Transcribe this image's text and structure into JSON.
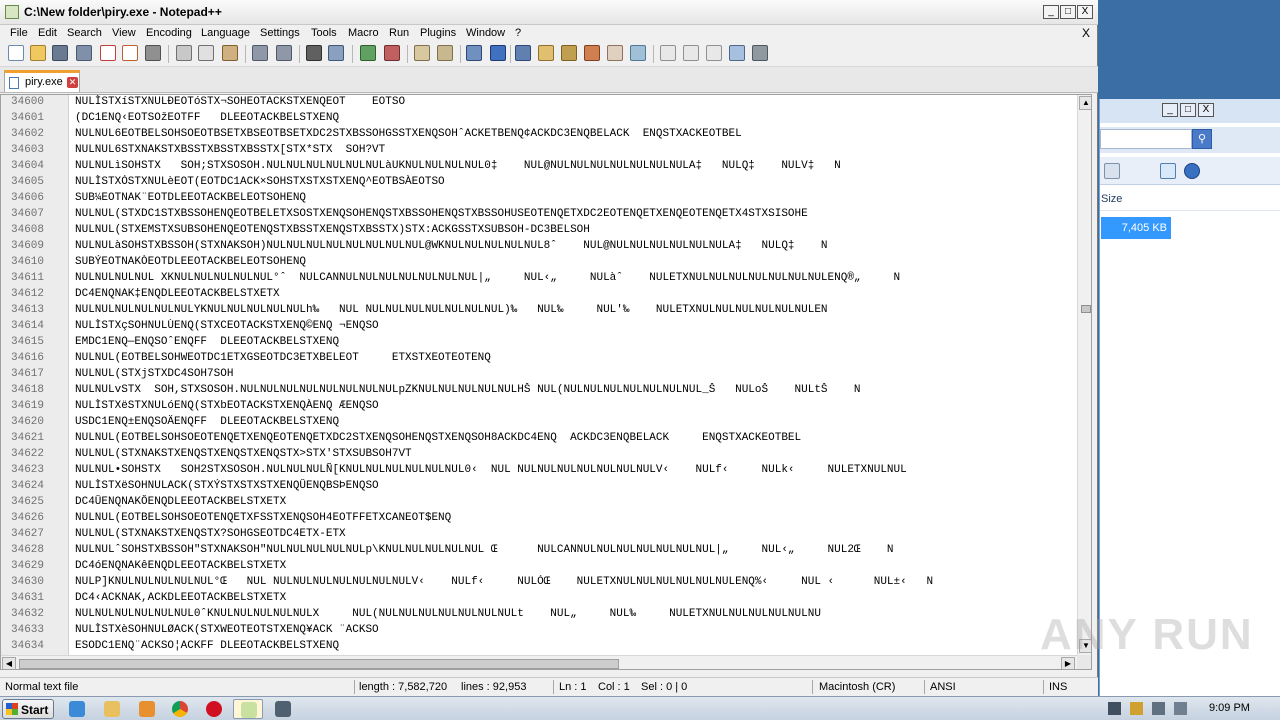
{
  "window": {
    "title": "C:\\New folder\\piry.exe - Notepad++",
    "controls": {
      "minimize": "_",
      "maximize": "□",
      "close": "X"
    }
  },
  "menu": {
    "items": [
      "File",
      "Edit",
      "Search",
      "View",
      "Encoding",
      "Language",
      "Settings",
      "Tools",
      "Macro",
      "Run",
      "Plugins",
      "Window",
      "?"
    ],
    "close": "X"
  },
  "toolbar": {
    "icons": [
      "new-file",
      "open-file",
      "save",
      "save-all",
      "close",
      "close-all",
      "print",
      "cut",
      "copy",
      "paste",
      "undo",
      "redo",
      "find",
      "replace",
      "zoom-in",
      "zoom-out",
      "sync-vertical",
      "sync-horizontal",
      "word-wrap",
      "show-all-chars",
      "indent-guide",
      "user-language",
      "doc-map",
      "function-list",
      "folder-workspace",
      "monitor",
      "record-macro",
      "stop-record",
      "play-macro",
      "run-macro-multiple",
      "save-macro"
    ]
  },
  "tab": {
    "label": "piry.exe",
    "close": "✕"
  },
  "editor": {
    "lines": [
      {
        "n": "34600",
        "t": "NULÌSTXíSTXNULÐEOTóSTX¬SOHEOTACKSTXENQEOT    EOTSO"
      },
      {
        "n": "34601",
        "t": "(DC1ENQ‹EOTSOžEOTFF   DLEEOTACKBELSTXENQ"
      },
      {
        "n": "34602",
        "t": "NULNUL6EOTBELSOHSOEOTBSETXBSEOTBSETXDC2STXBSSOHGSSTXENQSOHˆACKETBENQ¢ACKDC3ENQBELACK  ENQSTXACKEOTBEL"
      },
      {
        "n": "34603",
        "t": "NULNUL6STXNAKSTXBSSTXBSSTXBSSTX[STX*STX  SOH?VT"
      },
      {
        "n": "34604",
        "t": "NULNULìSOHSTX   SOH;STXSOSOH.NULNULNULNULNULNULàUKNULNULNULNUL0‡    NUL@NULNULNULNULNULNULNULA‡   NULQ‡    NULV‡   N"
      },
      {
        "n": "34605",
        "t": "NULÌSTXÓSTXNULèEOT(EOTDC1ACK×SOHSTXSTXSTXENQ^EOTBSÀEOTSO"
      },
      {
        "n": "34606",
        "t": "SUB¼EOTNAK¨EOTDLEEOTACKBELEOTSOHENQ"
      },
      {
        "n": "34607",
        "t": "NULNUL(STXDC1STXBSSOHENQEOTBELETXSOSTXENQSOHENQSTXBSSOHENQSTXBSSOHUSEOTENQETXDC2EOTENQETXENQEOTENQETX4STXSISOHE"
      },
      {
        "n": "34608",
        "t": "NULNUL(STXEMSTXSUBSOHENQEOTENQSTXBSSTXENQSTXBSSTX)STX:ACKGSSTXSUBSOH-DC3BELSOH"
      },
      {
        "n": "34609",
        "t": "NULNULàSOHSTXBSSOH(STXNAKSOH)NULNULNULNULNULNULNULNUL@WKNULNULNULNULNUL8ˆ    NUL@NULNULNULNULNULNULA‡   NULQ‡    N"
      },
      {
        "n": "34610",
        "t": "SUBÝEOTNAKÒEOTDLEEOTACKBELEOTSOHENQ"
      },
      {
        "n": "34611",
        "t": "NULNULNULNUL XKNULNULNULNULNUL°ˆ  NULCANNULNULNULNULNULNULNUL|„     NUL‹„     NULàˆ    NULETXNULNULNULNULNULNULNULENQ®„     N"
      },
      {
        "n": "34612",
        "t": "DC4ENQNAK‡ENQDLEEOTACKBELSTXETX"
      },
      {
        "n": "34613",
        "t": "NULNULNULNULNULNULYKNULNULNULNULNULh‰   NUL NULNULNULNULNULNULNUL)‰   NUL‰     NUL'‰    NULETXNULNULNULNULNULNULEN"
      },
      {
        "n": "34614",
        "t": "NULÌSTXçSOHNULÙENQ(STXCEOTACKSTXENQ©ENQ ¬ENQSO"
      },
      {
        "n": "34615",
        "t": "EMDC1ENQ—ENQSOˆENQFF  DLEEOTACKBELSTXENQ"
      },
      {
        "n": "34616",
        "t": "NULNUL(EOTBELSOHWEOTDC1ETXGSEOTDC3ETXBELEOT     ETXSTXEOTEOTENQ"
      },
      {
        "n": "34617",
        "t": "NULNUL(STXjSTXDC4SOH7SOH"
      },
      {
        "n": "34618",
        "t": "NULNULvSTX  SOH,STXSOSOH.NULNULNULNULNULNULNULNULpZKNULNULNULNULNULHŠ NUL(NULNULNULNULNULNULNUL_Š   NULoŠ    NULtŠ    N"
      },
      {
        "n": "34619",
        "t": "NULÌSTXëSTXNULóENQ(STXbEOTACKSTXENQÀENQ ÆENQSO"
      },
      {
        "n": "34620",
        "t": "USDC1ENQ±ENQSOÄENQFF  DLEEOTACKBELSTXENQ"
      },
      {
        "n": "34621",
        "t": "NULNUL(EOTBELSOHSOEOTENQETXENQEOTENQETXDC2STXENQSOHENQSTXENQSOH8ACKDC4ENQ  ACKDC3ENQBELACK     ENQSTXACKEOTBEL"
      },
      {
        "n": "34622",
        "t": "NULNUL(STXNAKSTXENQSTXENQSTXENQSTX>STX'STXSUBSOH7VT"
      },
      {
        "n": "34623",
        "t": "NULNUL•SOHSTX   SOH2STXSOSOH.NULNULNULÑ[KNULNULNULNULNULNUL0‹  NUL NULNULNULNULNULNULNULV‹    NULf‹     NULk‹     NULETXNULNUL"
      },
      {
        "n": "34624",
        "t": "NULÌSTXëSOHNULACK(STXÝSTXSTXSTXENQÛENQBSÞENQSO"
      },
      {
        "n": "34625",
        "t": "DC4ÛENQNAKÔENQDLEEOTACKBELSTXETX"
      },
      {
        "n": "34626",
        "t": "NULNUL(EOTBELSOHSOEOTENQETXFSSTXENQSOH4EOTFFETXCANEOT$ENQ"
      },
      {
        "n": "34627",
        "t": "NULNUL(STXNAKSTXENQSTX?SOHGSEOTDC4ETX-ETX"
      },
      {
        "n": "34628",
        "t": "NULNULˆSOHSTXBSSOH\"STXNAKSOH\"NULNULNULNULNULp\\KNULNULNULNULNUL Œ      NULCANNULNULNULNULNULNULNUL|„     NUL‹„     NUL2Œ    N"
      },
      {
        "n": "34629",
        "t": "DC4óENQNAKêENQDLEEOTACKBELSTXETX"
      },
      {
        "n": "34630",
        "t": "NULP]KNULNULNULNULNUL°Œ   NUL NULNULNULNULNULNULNULV‹    NULf‹     NULÓŒ    NULETXNULNULNULNULNULNULENQ%‹     NUL ‹      NUL±‹   N"
      },
      {
        "n": "34631",
        "t": "DC4‹ACKNAK,ACKDLEEOTACKBELSTXETX"
      },
      {
        "n": "34632",
        "t": "NULNULNULNULNULNUL0ˆKNULNULNULNULNULX     NUL(NULNULNULNULNULNULNULt    NUL„     NUL‰     NULETXNULNULNULNULNULNU"
      },
      {
        "n": "34633",
        "t": "NULÌSTXèSOHNULØACK(STXWEOTEOTSTXENQ¥ACK ¨ACKSO"
      },
      {
        "n": "34634",
        "t": "ESODC1ENQ¨ACKSO¦ACKFF DLEEOTACKBELSTXENQ"
      }
    ]
  },
  "status": {
    "file_type": "Normal text file",
    "length": "length : 7,582,720",
    "lines": "lines : 92,953",
    "ln": "Ln : 1",
    "col": "Col : 1",
    "sel": "Sel : 0 | 0",
    "eol": "Macintosh (CR)",
    "encoding": "ANSI",
    "mode": "INS"
  },
  "explorer": {
    "column_header": "Size",
    "selected_size": "7,405 KB",
    "search_icon": "magnifier-icon",
    "view_icon": "view-list-icon",
    "preview_icon": "preview-pane-icon",
    "help_icon": "help-icon"
  },
  "taskbar": {
    "start_label": "Start",
    "apps": [
      "ie-icon",
      "explorer-icon",
      "media-player-icon",
      "chrome-icon",
      "opera-icon",
      "notepadpp-icon",
      "task-manager-icon"
    ],
    "clock": "9:09 PM"
  },
  "watermark": "ANY RUN"
}
